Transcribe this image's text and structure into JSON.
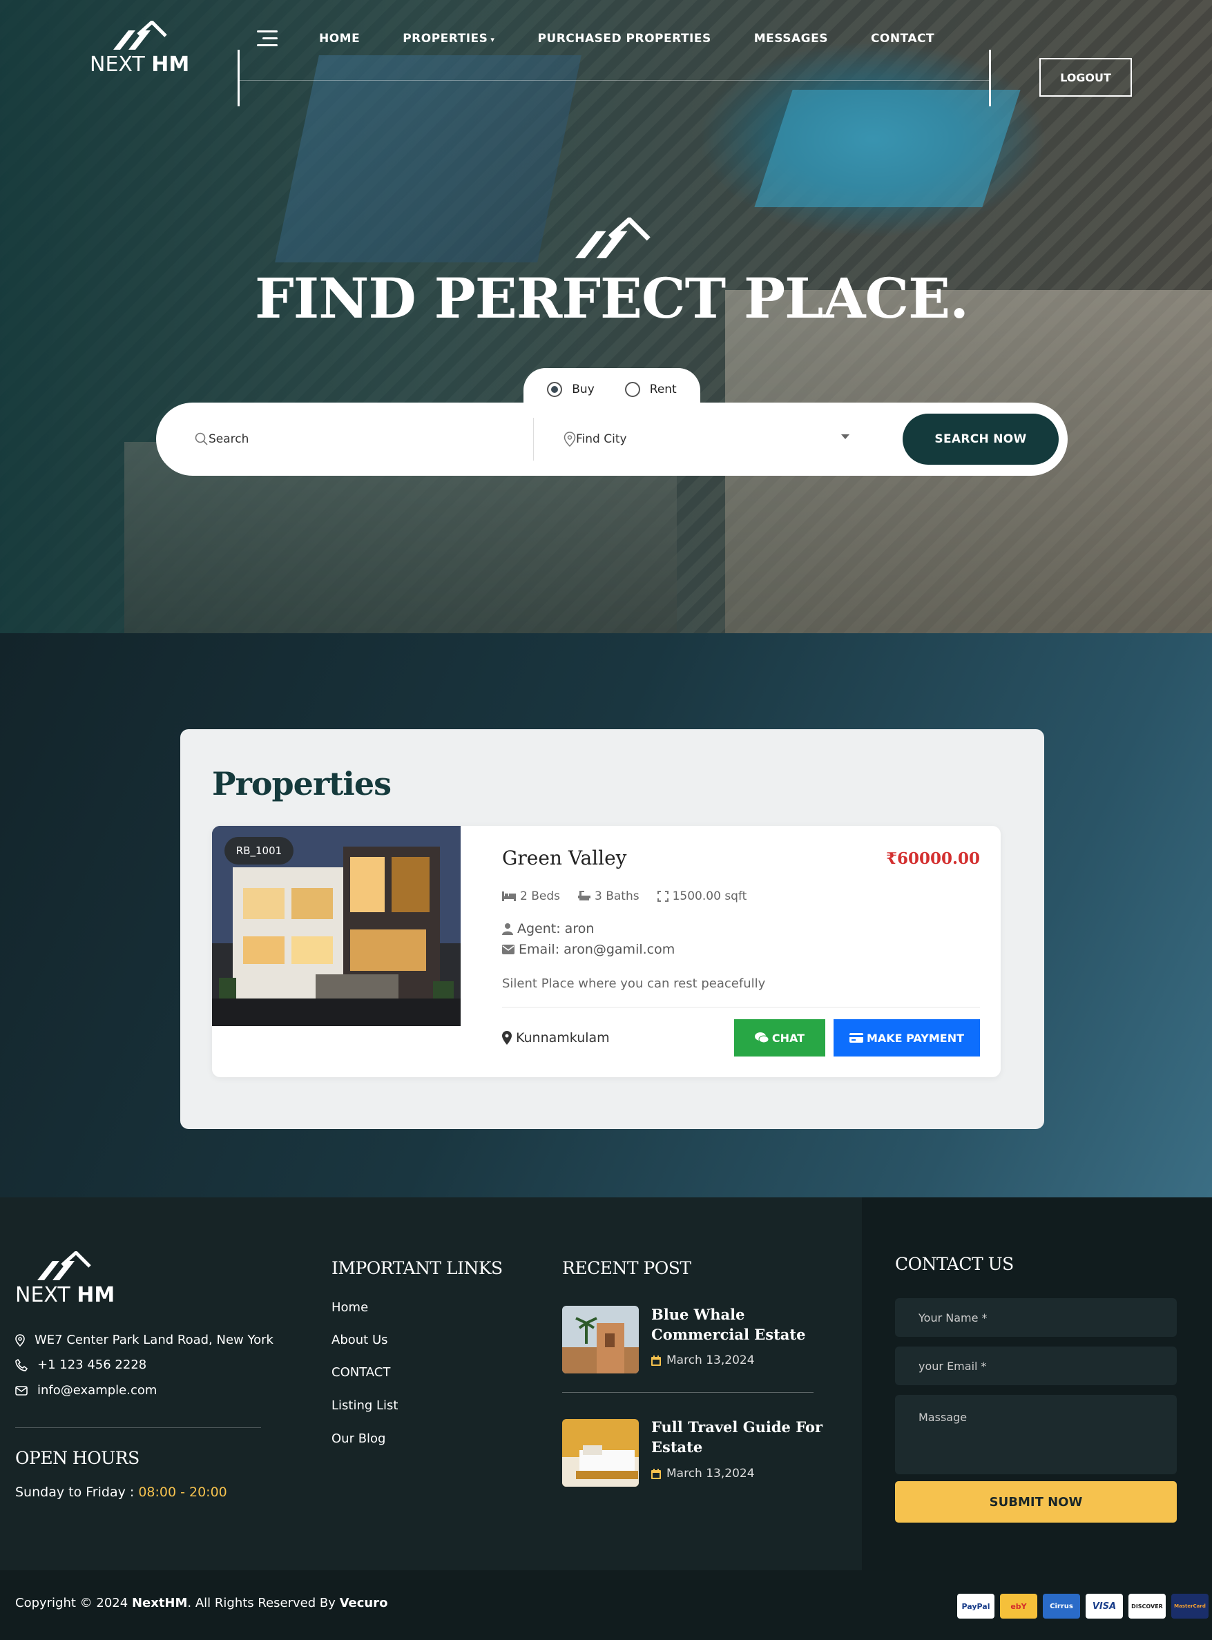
{
  "brand": {
    "logo_text_light": "NEXT",
    "logo_text_bold": "HM"
  },
  "nav": {
    "items": [
      {
        "label": "HOME"
      },
      {
        "label": "PROPERTIES"
      },
      {
        "label": "PURCHASED PROPERTIES"
      },
      {
        "label": "MESSAGES"
      },
      {
        "label": "CONTACT"
      }
    ],
    "logout_label": "LOGOUT"
  },
  "hero": {
    "title": "FIND PERFECT PLACE.",
    "type_options": [
      {
        "label": "Buy",
        "selected": true
      },
      {
        "label": "Rent",
        "selected": false
      }
    ],
    "search_placeholder": "Search",
    "city_placeholder": "Find City",
    "search_button": "SEARCH NOW"
  },
  "properties": {
    "title": "Properties",
    "cards": [
      {
        "badge": "RB_1001",
        "name": "Green Valley",
        "price": "₹60000.00",
        "beds": "2 Beds",
        "baths": "3 Baths",
        "area": "1500.00 sqft",
        "agent": "Agent: aron",
        "email": "Email: aron@gamil.com",
        "description": "Silent Place where you can rest peacefully",
        "location": "Kunnamkulam",
        "chat_label": "CHAT",
        "payment_label": "MAKE PAYMENT"
      }
    ]
  },
  "footer": {
    "address": "WE7 Center Park Land Road, New York",
    "phone": "+1 123 456 2228",
    "email": "info@example.com",
    "hours_heading": "OPEN HOURS",
    "hours_prefix": "Sunday to Friday : ",
    "hours_time": "08:00 - 20:00",
    "links_heading": "IMPORTANT LINKS",
    "links": [
      "Home",
      "About Us",
      "CONTACT",
      "Listing List",
      "Our Blog"
    ],
    "posts_heading": "RECENT POST",
    "posts": [
      {
        "title": "Blue Whale Commercial Estate",
        "date": "March 13,2024"
      },
      {
        "title": "Full Travel Guide For Estate",
        "date": "March 13,2024"
      }
    ],
    "contact_heading": "CONTACT US",
    "name_placeholder": "Your Name *",
    "email_placeholder": "your Email *",
    "message_placeholder": "Massage",
    "submit_label": "SUBMIT NOW",
    "copyright_prefix": "Copyright © 2024 ",
    "copyright_brand": "NextHM",
    "copyright_middle": ". All Rights Reserved By ",
    "copyright_by": "Vecuro",
    "payment_methods": [
      "PayPal",
      "ebY",
      "Cirrus",
      "VISA",
      "DISCOVER",
      "MasterCard"
    ]
  },
  "colors": {
    "primary_dark": "#143a3c",
    "accent_yellow": "#f6c24e",
    "price_red": "#d32f2f",
    "chat_green": "#28a745",
    "pay_blue": "#0d6efd"
  }
}
